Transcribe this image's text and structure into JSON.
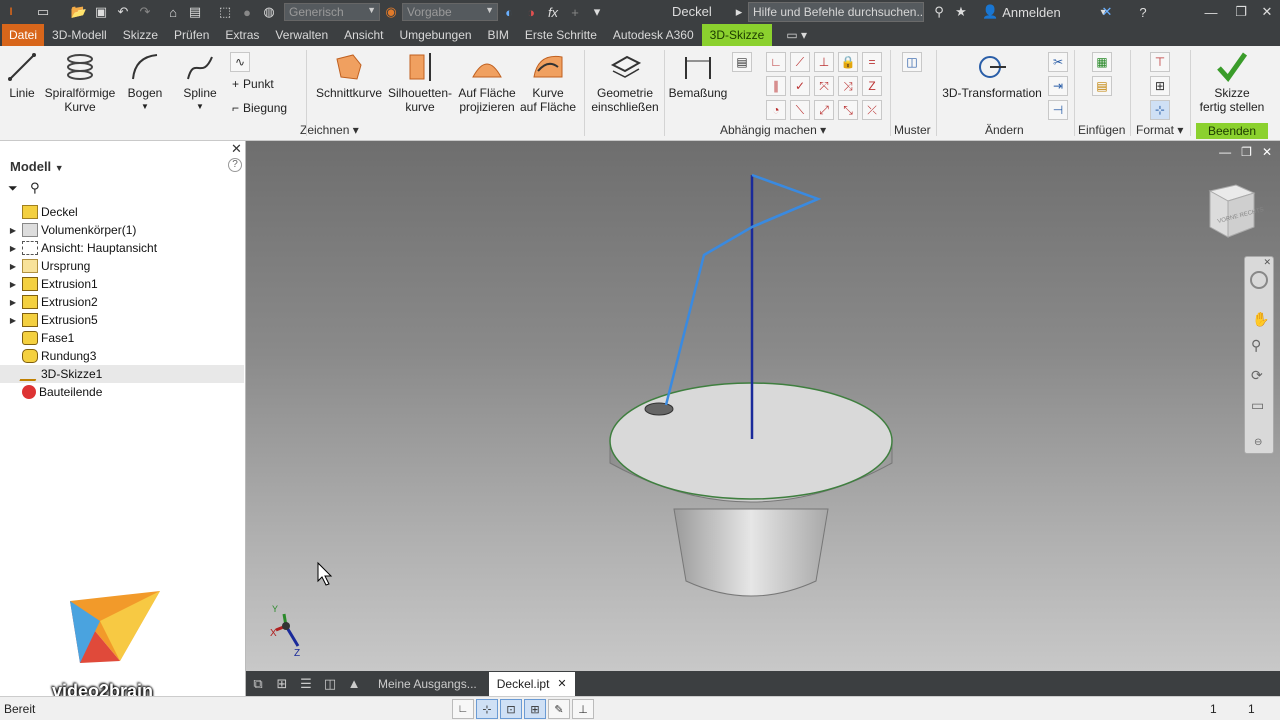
{
  "titlebar": {
    "material_placeholder": "Generisch",
    "appearance_placeholder": "Vorgabe",
    "document_title": "Deckel",
    "search_value": "Hilfe und Befehle durchsuchen...",
    "signin_label": "Anmelden"
  },
  "tabs": [
    "Datei",
    "3D-Modell",
    "Skizze",
    "Prüfen",
    "Extras",
    "Verwalten",
    "Ansicht",
    "Umgebungen",
    "BIM",
    "Erste Schritte",
    "Autodesk A360",
    "3D-Skizze"
  ],
  "ribbon": {
    "draw": {
      "line": "Linie",
      "spiral_1": "Spiralförmige",
      "spiral_2": "Kurve",
      "arc": "Bogen",
      "spline": "Spline",
      "point": "Punkt",
      "bend": "Biegung",
      "group": "Zeichnen"
    },
    "intersection_curve": "Schnittkurve",
    "silhouette_1": "Silhouetten-",
    "silhouette_2": "kurve",
    "project_1": "Auf Fläche",
    "project_2": "projizieren",
    "curve_on_face_1": "Kurve",
    "curve_on_face_2": "auf Fläche",
    "include_1": "Geometrie",
    "include_2": "einschließen",
    "dimension": "Bemaßung",
    "constrain_group": "Abhängig machen",
    "pattern_group": "Muster",
    "transform": "3D-Transformation",
    "modify_group": "Ändern",
    "insert_group": "Einfügen",
    "format_group": "Format",
    "finish_1": "Skizze",
    "finish_2": "fertig stellen",
    "exit_group": "Beenden"
  },
  "browser": {
    "header": "Modell",
    "items": [
      {
        "label": "Deckel"
      },
      {
        "label": "Volumenkörper(1)"
      },
      {
        "label": "Ansicht: Hauptansicht"
      },
      {
        "label": "Ursprung"
      },
      {
        "label": "Extrusion1"
      },
      {
        "label": "Extrusion2"
      },
      {
        "label": "Extrusion5"
      },
      {
        "label": "Fase1"
      },
      {
        "label": "Rundung3"
      },
      {
        "label": "3D-Skizze1"
      },
      {
        "label": "Bauteilende"
      }
    ]
  },
  "watermark": "video2brain",
  "viewcube_label": "VORNE RECHTS",
  "axes": {
    "x": "X",
    "y": "Y",
    "z": "Z"
  },
  "doc_tabs": {
    "home": "Meine Ausgangs...",
    "active": "Deckel.ipt"
  },
  "status": {
    "text": "Bereit",
    "count_1": "1",
    "count_2": "1"
  }
}
